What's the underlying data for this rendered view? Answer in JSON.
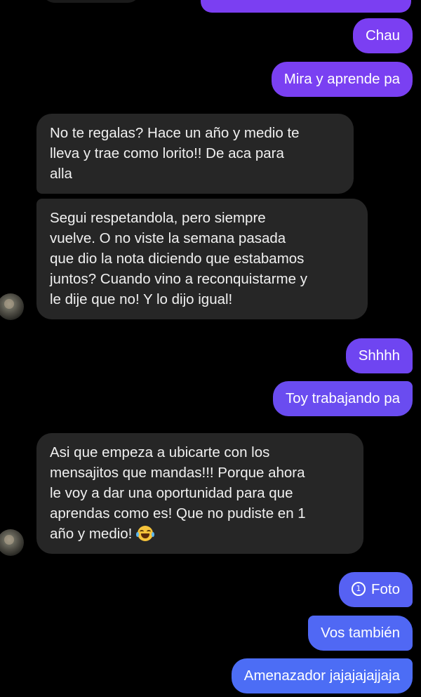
{
  "colors": {
    "background": "#000000",
    "incoming_bubble": "#262626",
    "outgoing_purple": "#7b3ff2",
    "outgoing_violet": "#6a4cf0",
    "outgoing_blue": "#4c6df5"
  },
  "messages": [
    {
      "dir": "out",
      "text": "Chau"
    },
    {
      "dir": "out",
      "text": "Mira y aprende pa"
    },
    {
      "dir": "in",
      "lines": [
        "No te regalas? Hace un año y medio te",
        "lleva y trae como lorito!! De aca para",
        "alla"
      ]
    },
    {
      "dir": "in",
      "lines": [
        "Segui respetandola, pero siempre",
        "vuelve. O no viste la semana pasada",
        "que dio la nota diciendo que estabamos",
        "juntos? Cuando vino a reconquistarme y",
        "le dije que no! Y lo dijo igual!"
      ]
    },
    {
      "dir": "out",
      "text": "Shhhh"
    },
    {
      "dir": "out",
      "text": "Toy trabajando pa"
    },
    {
      "dir": "in",
      "lines": [
        "Asi que empeza a ubicarte con los",
        "mensajitos que mandas!!! Porque ahora",
        "le voy a dar una oportunidad para que",
        "aprendas como es! Que no pudiste en 1",
        "año y medio!"
      ],
      "emoji": "tears-of-joy-emoji"
    },
    {
      "dir": "out",
      "text": "Foto",
      "icon": "view-once-photo-icon",
      "icon_glyph": "1"
    },
    {
      "dir": "out",
      "text": "Vos también"
    },
    {
      "dir": "out",
      "text": "Amenazador jajajajajjaja"
    }
  ]
}
